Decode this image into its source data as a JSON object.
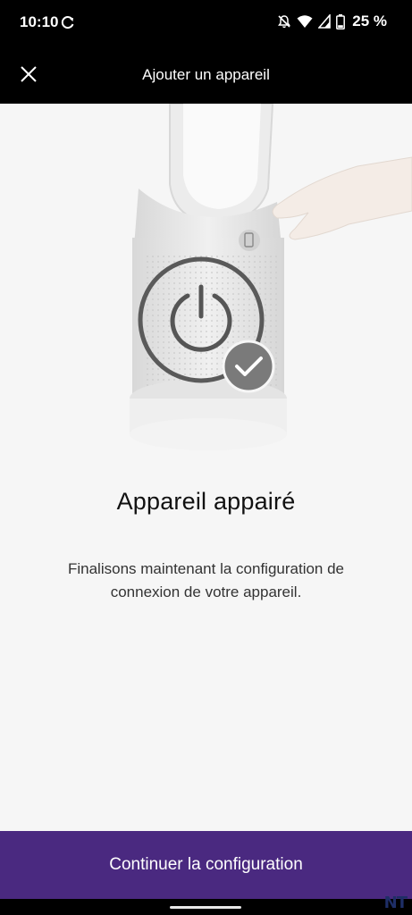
{
  "status_bar": {
    "time": "10:10",
    "battery_percent": "25 %",
    "icons": [
      "sync-icon",
      "notifications-off-icon",
      "wifi-icon",
      "signal-icon",
      "battery-icon"
    ]
  },
  "app_bar": {
    "title": "Ajouter un appareil",
    "close_icon": "close-icon"
  },
  "illustration": {
    "subject": "dyson-purifier-fan",
    "icons": [
      "power-icon",
      "checkmark-icon",
      "phone-icon",
      "hand-icon"
    ]
  },
  "main": {
    "heading": "Appareil appairé",
    "description": "Finalisons maintenant la configuration de connexion de votre appareil."
  },
  "cta": {
    "label": "Continuer la configuration"
  },
  "watermark": {
    "text": "NT"
  },
  "colors": {
    "accent": "#4a2980",
    "background": "#f6f6f6",
    "bar": "#000000"
  }
}
